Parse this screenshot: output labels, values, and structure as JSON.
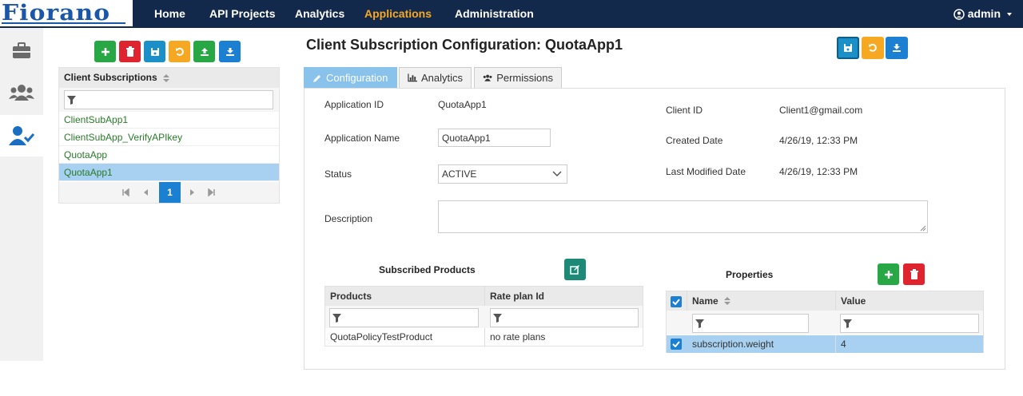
{
  "brand": {
    "logo_text": "Fiorano"
  },
  "topnav": {
    "items": [
      "Home",
      "API Projects",
      "Analytics",
      "Applications",
      "Administration"
    ],
    "user": "admin"
  },
  "left": {
    "grid_header": "Client Subscriptions",
    "rows": [
      "ClientSubApp1",
      "ClientSubApp_VerifyAPIkey",
      "QuotaApp",
      "QuotaApp1"
    ],
    "page": "1"
  },
  "main": {
    "title": "Client Subscription Configuration: QuotaApp1",
    "tabs": [
      "Configuration",
      "Analytics",
      "Permissions"
    ],
    "form": {
      "app_id_label": "Application ID",
      "app_id": "QuotaApp1",
      "app_name_label": "Application Name",
      "app_name": "QuotaApp1",
      "status_label": "Status",
      "status": "ACTIVE",
      "description_label": "Description",
      "description": "",
      "client_id_label": "Client ID",
      "client_id": "Client1@gmail.com",
      "created_label": "Created Date",
      "created": "4/26/19, 12:33 PM",
      "modified_label": "Last Modified Date",
      "modified": "4/26/19, 12:33 PM"
    },
    "products": {
      "title": "Subscribed Products",
      "columns": [
        "Products",
        "Rate plan Id"
      ],
      "rows": [
        [
          "QuotaPolicyTestProduct",
          "no rate plans"
        ]
      ]
    },
    "properties": {
      "title": "Properties",
      "columns": [
        "Name",
        "Value"
      ],
      "rows": [
        [
          "subscription.weight",
          "4"
        ]
      ]
    }
  },
  "colors": {
    "nav_bg": "#13294b",
    "accent": "#f7a823",
    "green": "#27a844",
    "red": "#e0242f",
    "blue": "#1b7fd2"
  }
}
